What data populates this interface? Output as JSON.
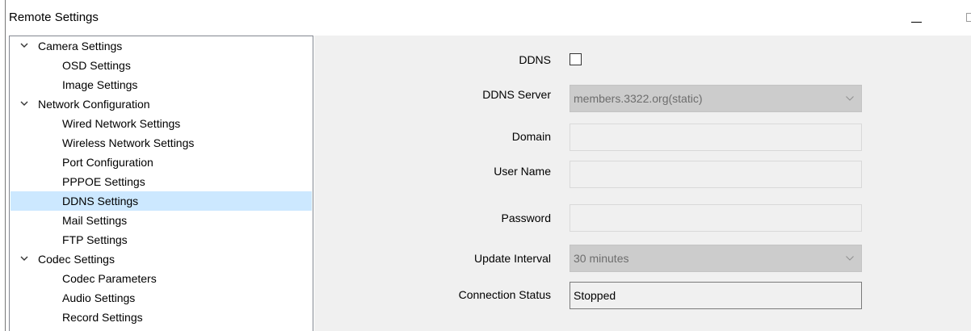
{
  "window": {
    "title": "Remote Settings"
  },
  "tree": {
    "groups": [
      {
        "label": "Camera Settings",
        "icon": "chevron-down-icon",
        "children": [
          "OSD Settings",
          "Image Settings"
        ]
      },
      {
        "label": "Network Configuration",
        "icon": "chevron-down-icon",
        "children": [
          "Wired Network Settings",
          "Wireless Network Settings",
          "Port Configuration",
          "PPPOE Settings",
          "DDNS Settings",
          "Mail Settings",
          "FTP Settings"
        ]
      },
      {
        "label": "Codec Settings",
        "icon": "chevron-down-icon",
        "children": [
          "Codec Parameters",
          "Audio Settings",
          "Record Settings"
        ]
      }
    ],
    "selected": "DDNS Settings",
    "selection_color": "#cce8ff"
  },
  "form": {
    "ddns_label": "DDNS",
    "ddns_checked": false,
    "server_label": "DDNS Server",
    "server_value": "members.3322.org(static)",
    "domain_label": "Domain",
    "domain_value": "",
    "username_label": "User Name",
    "username_value": "",
    "password_label": "Password",
    "password_value": "",
    "interval_label": "Update Interval",
    "interval_value": "30 minutes",
    "status_label": "Connection Status",
    "status_value": "Stopped"
  }
}
